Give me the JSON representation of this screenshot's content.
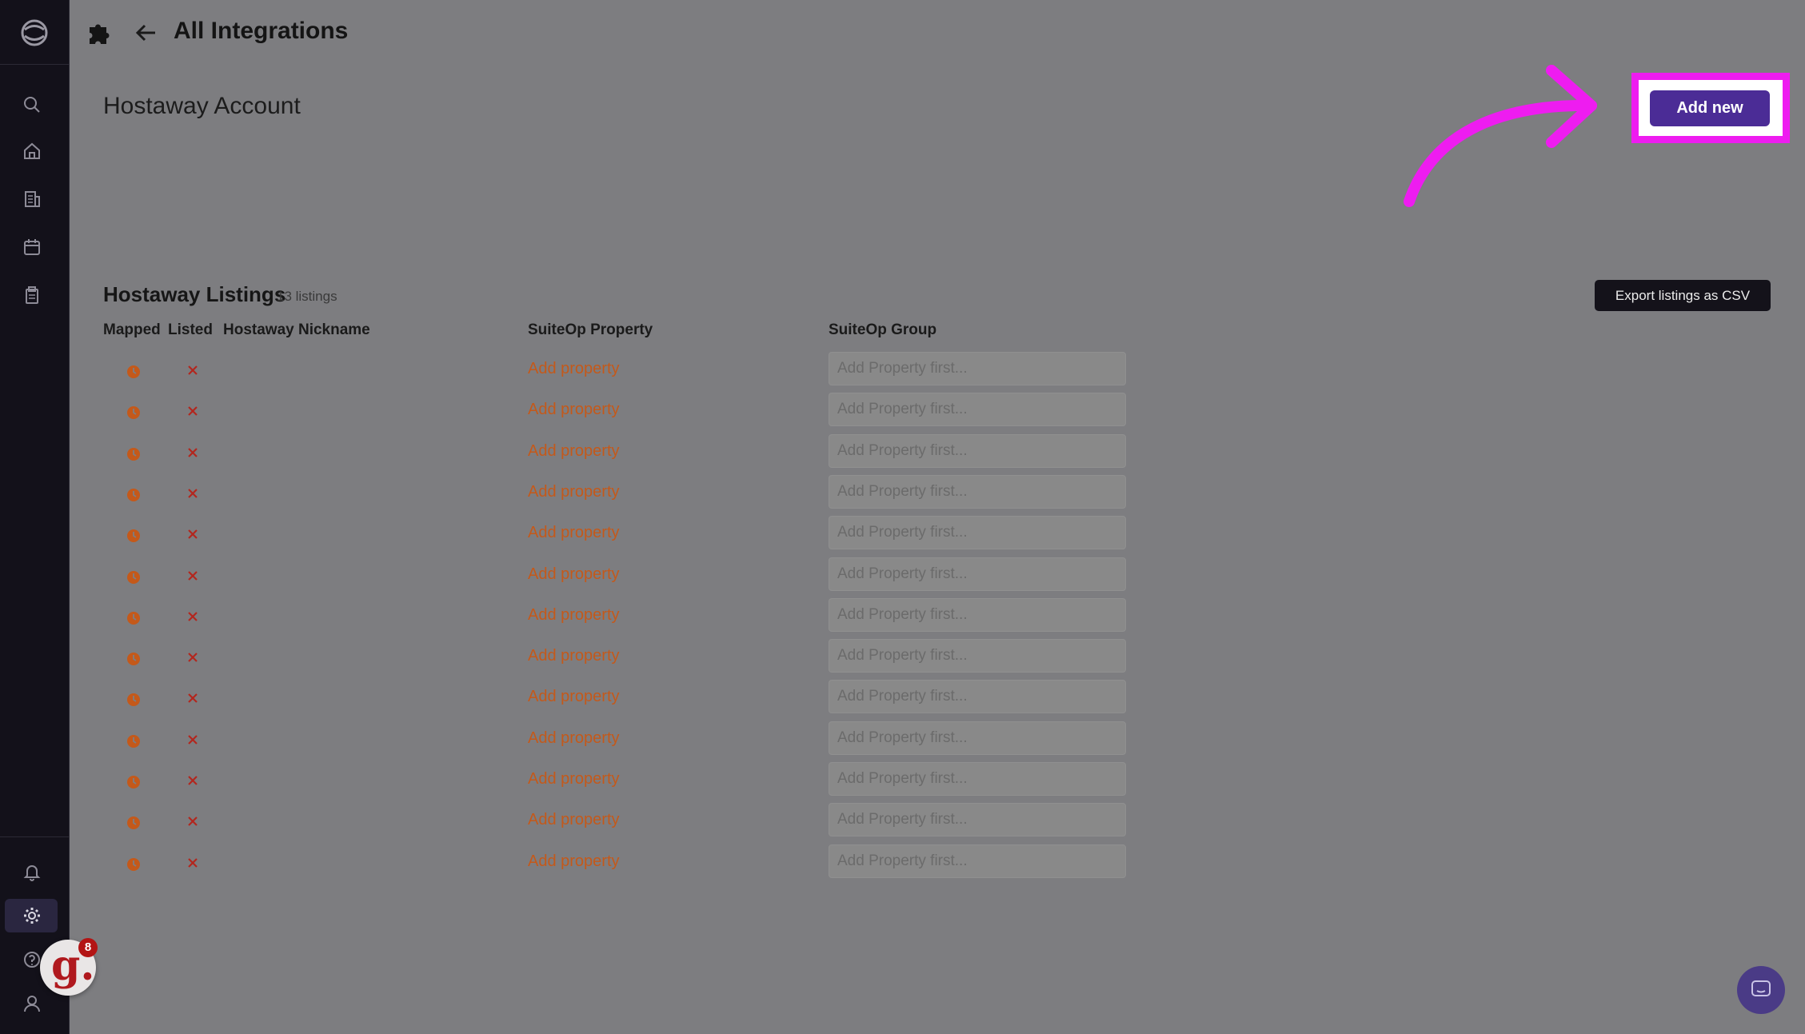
{
  "colors": {
    "accent": "#4b2c96",
    "highlight": "#ee1cf0",
    "link_orange": "#c4591a",
    "sidebar_bg": "#13111a",
    "overlay_bg": "#7d7d80"
  },
  "sidebar": {
    "icons": [
      "search-icon",
      "home-icon",
      "building-icon",
      "calendar-icon",
      "clipboard-icon",
      "bell-icon",
      "gear-icon",
      "help-icon",
      "user-icon"
    ]
  },
  "header": {
    "title": "All Integrations"
  },
  "account": {
    "title": "Hostaway Account",
    "add_new_label": "Add new"
  },
  "listings": {
    "title": "Hostaway Listings",
    "count_label": "13 listings",
    "export_label": "Export listings as CSV",
    "columns": {
      "mapped": "Mapped",
      "listed": "Listed",
      "nickname": "Hostaway Nickname",
      "property": "SuiteOp Property",
      "group": "SuiteOp Group"
    },
    "rows": [
      {
        "nickname": "",
        "property_action": "Add property",
        "group_placeholder": "Add Property first..."
      },
      {
        "nickname": "",
        "property_action": "Add property",
        "group_placeholder": "Add Property first..."
      },
      {
        "nickname": "",
        "property_action": "Add property",
        "group_placeholder": "Add Property first..."
      },
      {
        "nickname": "",
        "property_action": "Add property",
        "group_placeholder": "Add Property first..."
      },
      {
        "nickname": "",
        "property_action": "Add property",
        "group_placeholder": "Add Property first..."
      },
      {
        "nickname": "",
        "property_action": "Add property",
        "group_placeholder": "Add Property first..."
      },
      {
        "nickname": "",
        "property_action": "Add property",
        "group_placeholder": "Add Property first..."
      },
      {
        "nickname": "",
        "property_action": "Add property",
        "group_placeholder": "Add Property first..."
      },
      {
        "nickname": "",
        "property_action": "Add property",
        "group_placeholder": "Add Property first..."
      },
      {
        "nickname": "",
        "property_action": "Add property",
        "group_placeholder": "Add Property first..."
      },
      {
        "nickname": "",
        "property_action": "Add property",
        "group_placeholder": "Add Property first..."
      },
      {
        "nickname": "",
        "property_action": "Add property",
        "group_placeholder": "Add Property first..."
      },
      {
        "nickname": "",
        "property_action": "Add property",
        "group_placeholder": "Add Property first..."
      }
    ]
  },
  "widgets": {
    "g_letter": "g.",
    "g_badge": "8"
  }
}
